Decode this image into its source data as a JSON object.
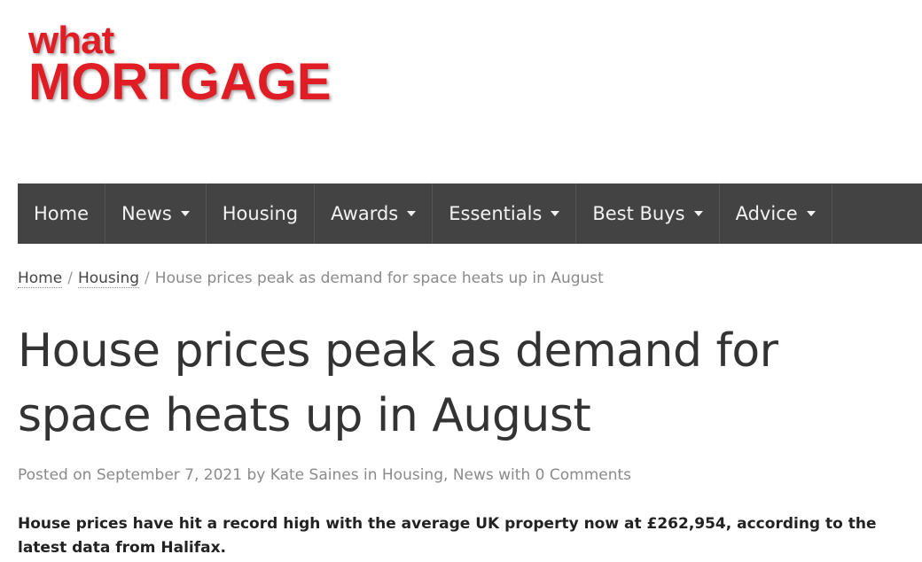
{
  "logo": {
    "line1": "what",
    "line2": "MORTGAGE",
    "color": "#e01c24"
  },
  "nav": {
    "background": "#434343",
    "items": [
      {
        "label": "Home",
        "dropdown": false
      },
      {
        "label": "News",
        "dropdown": true
      },
      {
        "label": "Housing",
        "dropdown": false
      },
      {
        "label": "Awards",
        "dropdown": true
      },
      {
        "label": "Essentials",
        "dropdown": true
      },
      {
        "label": "Best Buys",
        "dropdown": true
      },
      {
        "label": "Advice",
        "dropdown": true
      }
    ]
  },
  "breadcrumb": {
    "home": "Home",
    "separator": "/",
    "category": "Housing",
    "current": "House prices peak as demand for space heats up in August"
  },
  "article": {
    "title": "House prices peak as demand for space heats up in August",
    "meta": {
      "posted_on": "Posted on",
      "date": "September 7, 2021",
      "by": "by",
      "author": "Kate Saines",
      "in": "in",
      "category1": "Housing",
      "comma": ",",
      "category2": "News",
      "with": "with",
      "comments": "0 Comments"
    },
    "lead": "House prices have hit a record high with the average UK property now at £262,954, according to the latest data from Halifax."
  }
}
